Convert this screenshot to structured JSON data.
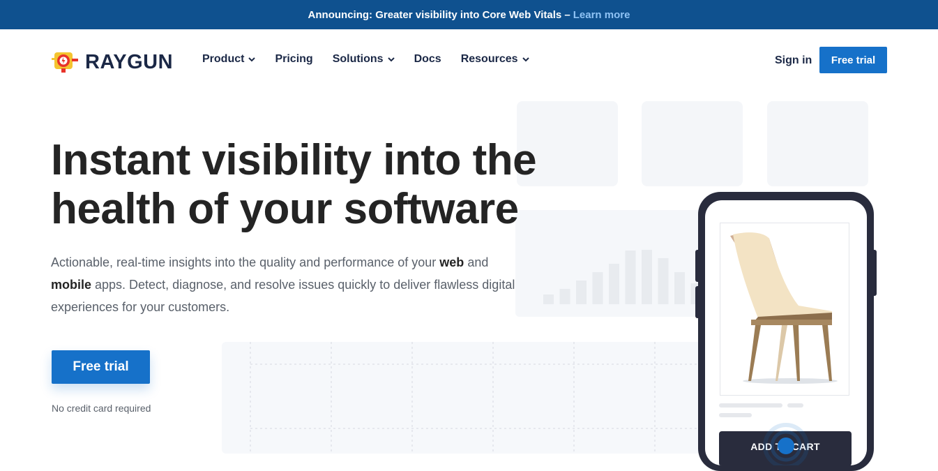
{
  "announcement": {
    "text": "Announcing: Greater visibility into Core Web Vitals –",
    "link": "Learn more"
  },
  "brand": {
    "name": "RAYGUN"
  },
  "nav": {
    "items": [
      {
        "label": "Product",
        "dropdown": true
      },
      {
        "label": "Pricing",
        "dropdown": false
      },
      {
        "label": "Solutions",
        "dropdown": true
      },
      {
        "label": "Docs",
        "dropdown": false
      },
      {
        "label": "Resources",
        "dropdown": true
      }
    ],
    "signin": "Sign in",
    "trial": "Free trial"
  },
  "hero": {
    "title_line1": "Instant visibility into the",
    "title_line2": "health of your software",
    "sub_part1": "Actionable, real-time insights into the quality and performance of your ",
    "sub_bold1": "web",
    "sub_part2": " and ",
    "sub_bold2": "mobile",
    "sub_part3": " apps. Detect, diagnose, and resolve issues quickly to deliver flawless digital experiences for your customers.",
    "cta": "Free trial",
    "note": "No credit card required"
  },
  "phone": {
    "cart_label": "ADD TO CART"
  },
  "colors": {
    "announce_bg": "#0f518f",
    "accent": "#1671c9",
    "navy": "#1b2846",
    "phone": "#292c3d"
  },
  "illustration": {
    "bar_values": [
      14,
      22,
      34,
      46,
      58,
      77,
      78,
      66,
      46,
      30
    ]
  }
}
